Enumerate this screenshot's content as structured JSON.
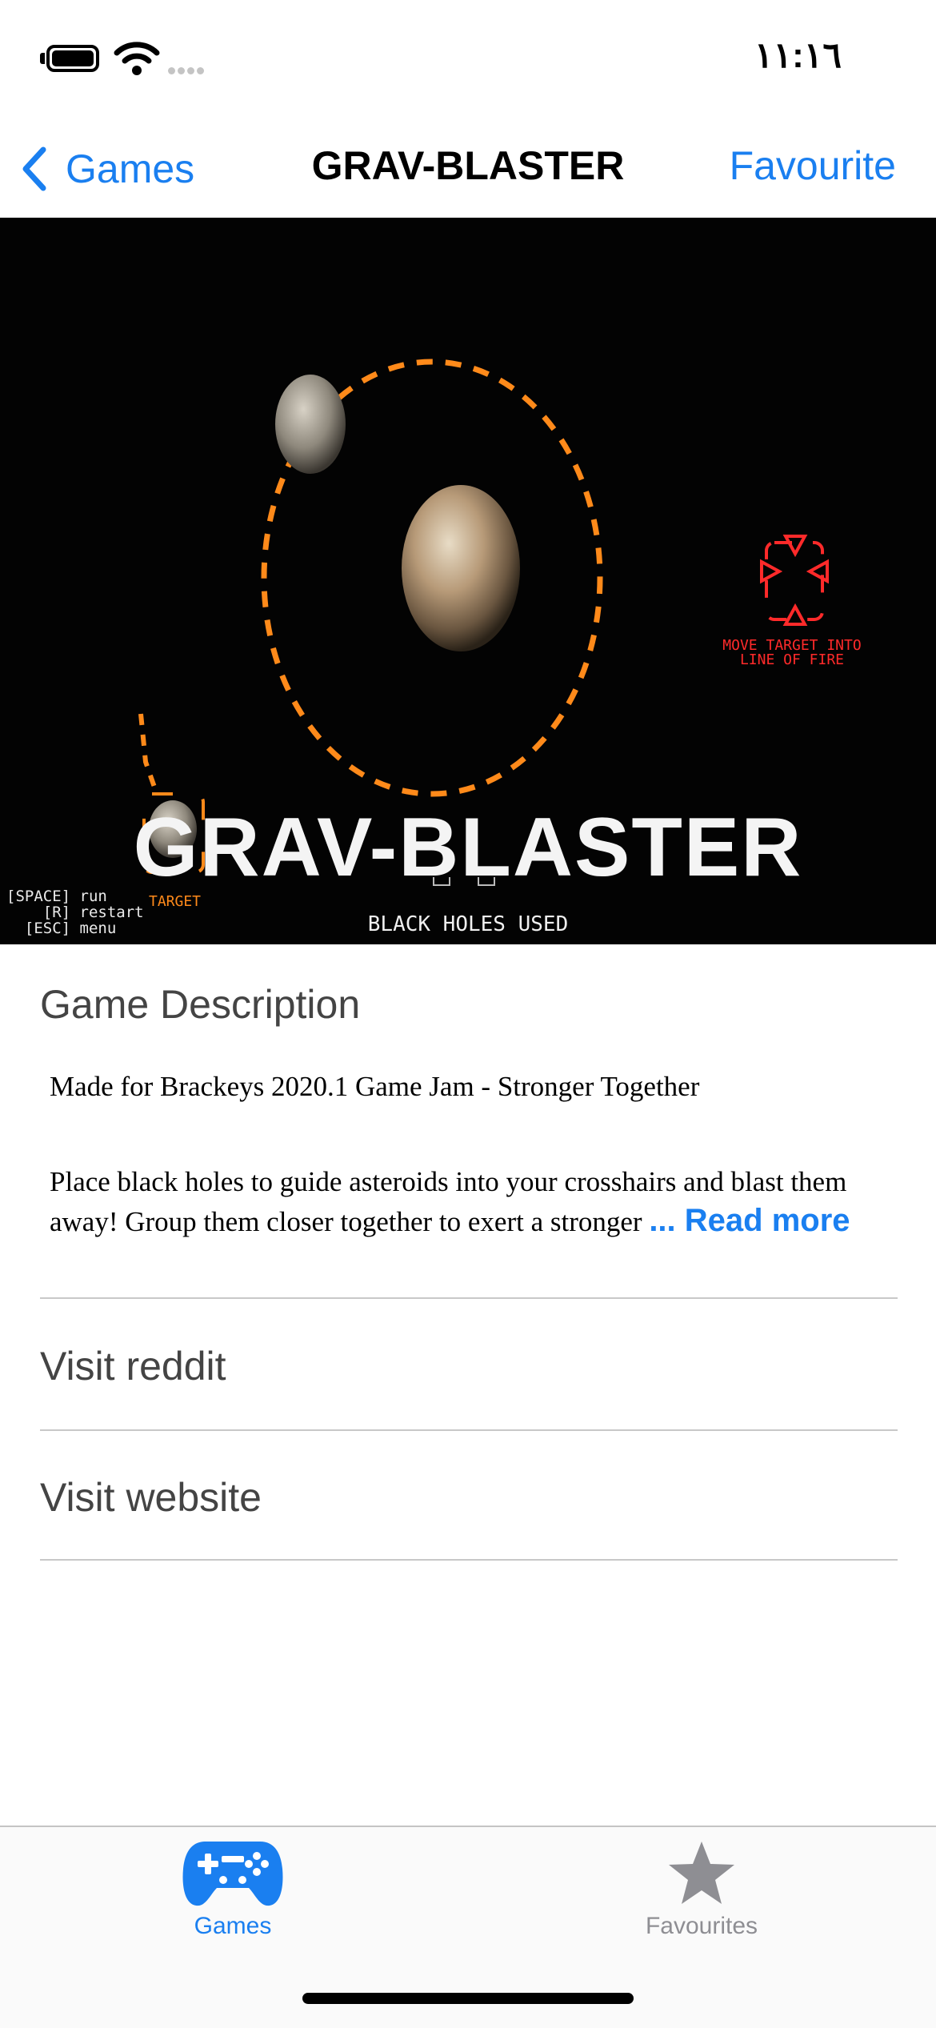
{
  "status_bar": {
    "time": "١١:١٦"
  },
  "nav": {
    "back_label": "Games",
    "title": "GRAV-BLASTER",
    "favourite_label": "Favourite"
  },
  "hero": {
    "title": "GRAV-BLASTER",
    "target_message": "MOVE TARGET INTO LINE OF FIRE",
    "target_label": "TARGET",
    "controls": "[SPACE] run\n    [R] restart\n  [ESC] menu",
    "black_holes_label": "BLACK HOLES USED"
  },
  "description": {
    "heading": "Game Description",
    "line1": "Made for Brackeys 2020.1 Game Jam - Stronger Together",
    "body": "Place black holes to guide asteroids into your crosshairs and blast them away! Group them closer together to exert a stronger",
    "read_more": "... Read more"
  },
  "links": {
    "reddit": "Visit reddit",
    "website": "Visit website"
  },
  "tab_bar": {
    "items": [
      {
        "label": "Games",
        "icon": "gamecontroller-icon",
        "active": true
      },
      {
        "label": "Favourites",
        "icon": "star-icon",
        "active": false
      }
    ]
  },
  "colors": {
    "accent": "#1a7ff0",
    "inactive": "#8e8e93",
    "orbit": "#ff8a1a",
    "target_red": "#ff2a2a"
  }
}
